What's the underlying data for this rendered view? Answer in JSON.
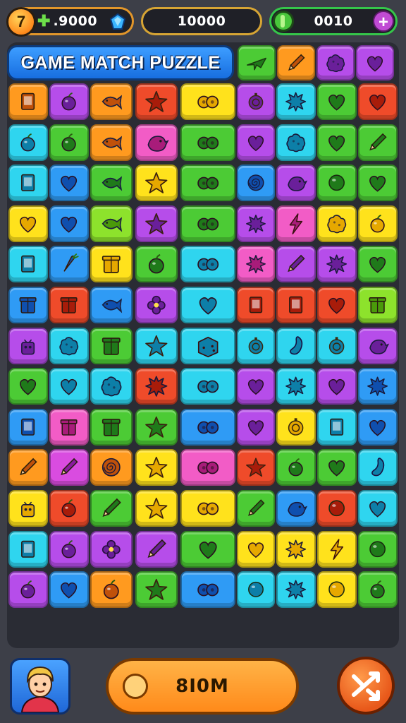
{
  "hud": {
    "coins": ".9000",
    "score": "10000",
    "gems": "0010",
    "coin_glyph": "7"
  },
  "title": "GAME MATCH PUZZLE",
  "play_button": {
    "label": "8I0M"
  },
  "colors": {
    "orange": "#ff9a1f",
    "purple": "#b64dea",
    "blue": "#2f9bf5",
    "red": "#ef4b2a",
    "yellow": "#ffe21c",
    "green": "#4ccb35",
    "cyan": "#2fd5ef",
    "pink": "#f25cc6",
    "lime": "#8de22c",
    "magenta": "#d94ce0"
  },
  "header_tiles": [
    {
      "color": "green",
      "icon": "plane"
    },
    {
      "color": "orange",
      "icon": "pencil"
    },
    {
      "color": "purple",
      "icon": "blob"
    },
    {
      "color": "purple",
      "icon": "heart"
    }
  ],
  "rows": [
    [
      {
        "c": "orange",
        "i": "card",
        "w": 1
      },
      {
        "c": "purple",
        "i": "fruit",
        "w": 1
      },
      {
        "c": "orange",
        "i": "fish",
        "w": 1
      },
      {
        "c": "red",
        "i": "star",
        "w": 1
      },
      {
        "c": "yellow",
        "i": "pair",
        "w": 2
      },
      {
        "c": "purple",
        "i": "coin",
        "w": 1
      },
      {
        "c": "cyan",
        "i": "splat",
        "w": 1
      },
      {
        "c": "green",
        "i": "heart",
        "w": 1
      },
      {
        "c": "red",
        "i": "heart",
        "w": 1
      }
    ],
    [
      {
        "c": "cyan",
        "i": "fruit",
        "w": 1
      },
      {
        "c": "green",
        "i": "fruit",
        "w": 1
      },
      {
        "c": "orange",
        "i": "fish",
        "w": 1
      },
      {
        "c": "pink",
        "i": "bird",
        "w": 1
      },
      {
        "c": "green",
        "i": "pair",
        "w": 2
      },
      {
        "c": "purple",
        "i": "heart",
        "w": 1
      },
      {
        "c": "cyan",
        "i": "blob",
        "w": 1
      },
      {
        "c": "green",
        "i": "heart",
        "w": 1
      },
      {
        "c": "green",
        "i": "pencil",
        "w": 1
      }
    ],
    [
      {
        "c": "cyan",
        "i": "card",
        "w": 1
      },
      {
        "c": "blue",
        "i": "heart",
        "w": 1
      },
      {
        "c": "green",
        "i": "fish",
        "w": 1
      },
      {
        "c": "yellow",
        "i": "star",
        "w": 1
      },
      {
        "c": "green",
        "i": "pair",
        "w": 2
      },
      {
        "c": "blue",
        "i": "swirl",
        "w": 1
      },
      {
        "c": "purple",
        "i": "bird",
        "w": 1
      },
      {
        "c": "green",
        "i": "ball",
        "w": 1
      },
      {
        "c": "green",
        "i": "heart",
        "w": 1
      }
    ],
    [
      {
        "c": "yellow",
        "i": "heart",
        "w": 1
      },
      {
        "c": "blue",
        "i": "heart",
        "w": 1
      },
      {
        "c": "lime",
        "i": "fish",
        "w": 1
      },
      {
        "c": "purple",
        "i": "star",
        "w": 1
      },
      {
        "c": "green",
        "i": "pair",
        "w": 2
      },
      {
        "c": "purple",
        "i": "splat",
        "w": 1
      },
      {
        "c": "pink",
        "i": "bolt",
        "w": 1
      },
      {
        "c": "yellow",
        "i": "blob",
        "w": 1
      },
      {
        "c": "yellow",
        "i": "fruit",
        "w": 1
      }
    ],
    [
      {
        "c": "cyan",
        "i": "card",
        "w": 1
      },
      {
        "c": "blue",
        "i": "carrot",
        "w": 1
      },
      {
        "c": "yellow",
        "i": "box",
        "w": 1
      },
      {
        "c": "green",
        "i": "fruit",
        "w": 1
      },
      {
        "c": "cyan",
        "i": "pair",
        "w": 2
      },
      {
        "c": "pink",
        "i": "splat",
        "w": 1
      },
      {
        "c": "purple",
        "i": "pencil",
        "w": 1
      },
      {
        "c": "purple",
        "i": "splat",
        "w": 1
      },
      {
        "c": "green",
        "i": "heart",
        "w": 1
      }
    ],
    [
      {
        "c": "blue",
        "i": "box",
        "w": 1
      },
      {
        "c": "red",
        "i": "box",
        "w": 1
      },
      {
        "c": "blue",
        "i": "fish",
        "w": 1
      },
      {
        "c": "purple",
        "i": "flower",
        "w": 1
      },
      {
        "c": "cyan",
        "i": "heart",
        "w": 2
      },
      {
        "c": "red",
        "i": "card",
        "w": 1
      },
      {
        "c": "red",
        "i": "card",
        "w": 1
      },
      {
        "c": "red",
        "i": "heart",
        "w": 1
      },
      {
        "c": "lime",
        "i": "box",
        "w": 1
      }
    ],
    [
      {
        "c": "purple",
        "i": "bot",
        "w": 1
      },
      {
        "c": "cyan",
        "i": "blob",
        "w": 1
      },
      {
        "c": "green",
        "i": "box",
        "w": 1
      },
      {
        "c": "cyan",
        "i": "star",
        "w": 1
      },
      {
        "c": "cyan",
        "i": "dice",
        "w": 2
      },
      {
        "c": "cyan",
        "i": "coin",
        "w": 1
      },
      {
        "c": "cyan",
        "i": "bean",
        "w": 1
      },
      {
        "c": "cyan",
        "i": "coin",
        "w": 1
      },
      {
        "c": "purple",
        "i": "bird",
        "w": 1
      }
    ],
    [
      {
        "c": "green",
        "i": "heart",
        "w": 1
      },
      {
        "c": "cyan",
        "i": "heart",
        "w": 1
      },
      {
        "c": "cyan",
        "i": "blob",
        "w": 1
      },
      {
        "c": "red",
        "i": "splat",
        "w": 1
      },
      {
        "c": "cyan",
        "i": "pair",
        "w": 2
      },
      {
        "c": "purple",
        "i": "heart",
        "w": 1
      },
      {
        "c": "cyan",
        "i": "splat",
        "w": 1
      },
      {
        "c": "purple",
        "i": "heart",
        "w": 1
      },
      {
        "c": "blue",
        "i": "splat",
        "w": 1
      }
    ],
    [
      {
        "c": "blue",
        "i": "card",
        "w": 1
      },
      {
        "c": "pink",
        "i": "box",
        "w": 1
      },
      {
        "c": "green",
        "i": "box",
        "w": 1
      },
      {
        "c": "green",
        "i": "star",
        "w": 1
      },
      {
        "c": "blue",
        "i": "pair",
        "w": 2
      },
      {
        "c": "purple",
        "i": "heart",
        "w": 1
      },
      {
        "c": "yellow",
        "i": "coin",
        "w": 1
      },
      {
        "c": "cyan",
        "i": "card",
        "w": 1
      },
      {
        "c": "blue",
        "i": "heart",
        "w": 1
      }
    ],
    [
      {
        "c": "orange",
        "i": "pencil",
        "w": 1
      },
      {
        "c": "magenta",
        "i": "pencil",
        "w": 1
      },
      {
        "c": "orange",
        "i": "swirl",
        "w": 1
      },
      {
        "c": "yellow",
        "i": "star",
        "w": 1
      },
      {
        "c": "pink",
        "i": "pair",
        "w": 2
      },
      {
        "c": "red",
        "i": "star",
        "w": 1
      },
      {
        "c": "green",
        "i": "fruit",
        "w": 1
      },
      {
        "c": "green",
        "i": "heart",
        "w": 1
      },
      {
        "c": "cyan",
        "i": "bean",
        "w": 1
      }
    ],
    [
      {
        "c": "yellow",
        "i": "bot",
        "w": 1
      },
      {
        "c": "red",
        "i": "fruit",
        "w": 1
      },
      {
        "c": "green",
        "i": "pencil",
        "w": 1
      },
      {
        "c": "yellow",
        "i": "star",
        "w": 1
      },
      {
        "c": "yellow",
        "i": "pair",
        "w": 2
      },
      {
        "c": "green",
        "i": "pencil",
        "w": 1
      },
      {
        "c": "blue",
        "i": "bird",
        "w": 1
      },
      {
        "c": "red",
        "i": "ball",
        "w": 1
      },
      {
        "c": "cyan",
        "i": "heart",
        "w": 1
      }
    ],
    [
      {
        "c": "cyan",
        "i": "card",
        "w": 1
      },
      {
        "c": "purple",
        "i": "fruit",
        "w": 1
      },
      {
        "c": "purple",
        "i": "flower",
        "w": 1
      },
      {
        "c": "purple",
        "i": "pencil",
        "w": 1
      },
      {
        "c": "green",
        "i": "heart",
        "w": 2
      },
      {
        "c": "yellow",
        "i": "heart",
        "w": 1
      },
      {
        "c": "yellow",
        "i": "splat",
        "w": 1
      },
      {
        "c": "yellow",
        "i": "bolt",
        "w": 1
      },
      {
        "c": "green",
        "i": "ball",
        "w": 1
      }
    ],
    [
      {
        "c": "purple",
        "i": "fruit",
        "w": 1
      },
      {
        "c": "blue",
        "i": "heart",
        "w": 1
      },
      {
        "c": "orange",
        "i": "fruit",
        "w": 1
      },
      {
        "c": "green",
        "i": "star",
        "w": 1
      },
      {
        "c": "blue",
        "i": "pair",
        "w": 2
      },
      {
        "c": "cyan",
        "i": "ball",
        "w": 1
      },
      {
        "c": "cyan",
        "i": "splat",
        "w": 1
      },
      {
        "c": "yellow",
        "i": "ball",
        "w": 1
      },
      {
        "c": "green",
        "i": "fruit",
        "w": 1
      }
    ]
  ]
}
